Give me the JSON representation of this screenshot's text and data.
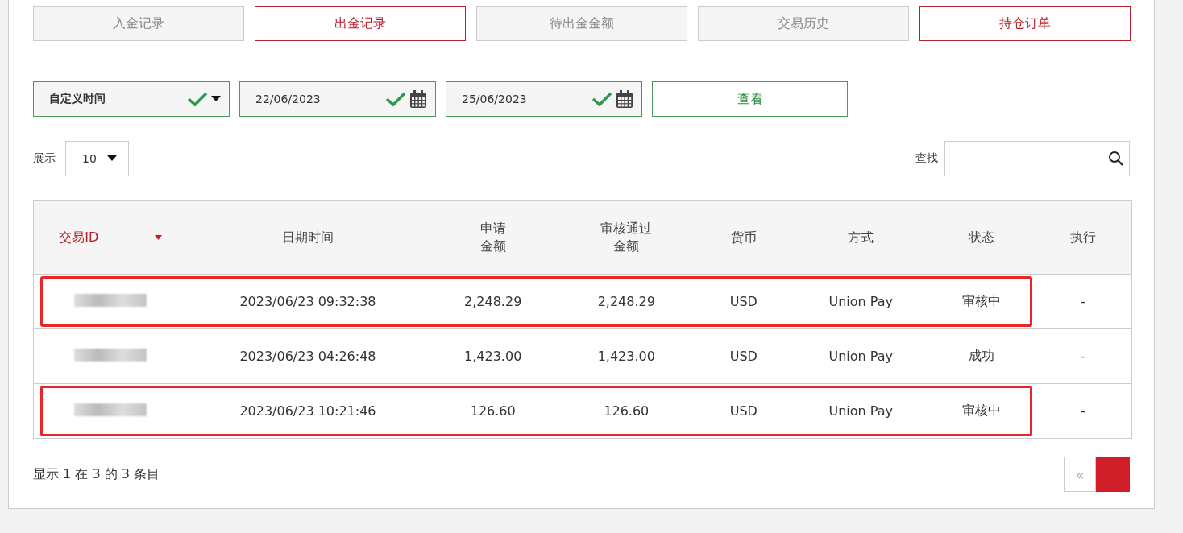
{
  "tabs": [
    {
      "label": "入金记录",
      "selected": false
    },
    {
      "label": "出金记录",
      "selected": true
    },
    {
      "label": "待出金金额",
      "selected": false
    },
    {
      "label": "交易历史",
      "selected": false
    },
    {
      "label": "持仓订单",
      "selected": true
    }
  ],
  "filters": {
    "period": {
      "value": "自定义时间",
      "valid": true
    },
    "start_date": {
      "value": "22/06/2023",
      "valid": true
    },
    "end_date": {
      "value": "25/06/2023",
      "valid": true
    },
    "view_button": "查看"
  },
  "page_size": {
    "label": "展示",
    "value": "10"
  },
  "search": {
    "label": "查找"
  },
  "table": {
    "columns": [
      {
        "lines": [
          "交易ID"
        ],
        "sorted": true
      },
      {
        "lines": [
          "日期时间"
        ],
        "sorted": false
      },
      {
        "lines": [
          "申请",
          "金额"
        ],
        "sorted": false
      },
      {
        "lines": [
          "审核通过",
          "金额"
        ],
        "sorted": false
      },
      {
        "lines": [
          "货币"
        ],
        "sorted": false
      },
      {
        "lines": [
          "方式"
        ],
        "sorted": false
      },
      {
        "lines": [
          "状态"
        ],
        "sorted": false
      },
      {
        "lines": [
          "执行"
        ],
        "sorted": false
      }
    ],
    "rows": [
      {
        "highlighted": true,
        "cells": [
          "",
          "2023/06/23 09:32:38",
          "2,248.29",
          "2,248.29",
          "USD",
          "Union Pay",
          "审核中",
          "-"
        ]
      },
      {
        "highlighted": false,
        "cells": [
          "",
          "2023/06/23 04:26:48",
          "1,423.00",
          "1,423.00",
          "USD",
          "Union Pay",
          "成功",
          "-"
        ]
      },
      {
        "highlighted": true,
        "cells": [
          "",
          "2023/06/23 10:21:46",
          "126.60",
          "126.60",
          "USD",
          "Union Pay",
          "审核中",
          "-"
        ]
      }
    ]
  },
  "footer": {
    "summary": "显示 1 在 3 的 3 条目",
    "prev": "«"
  }
}
